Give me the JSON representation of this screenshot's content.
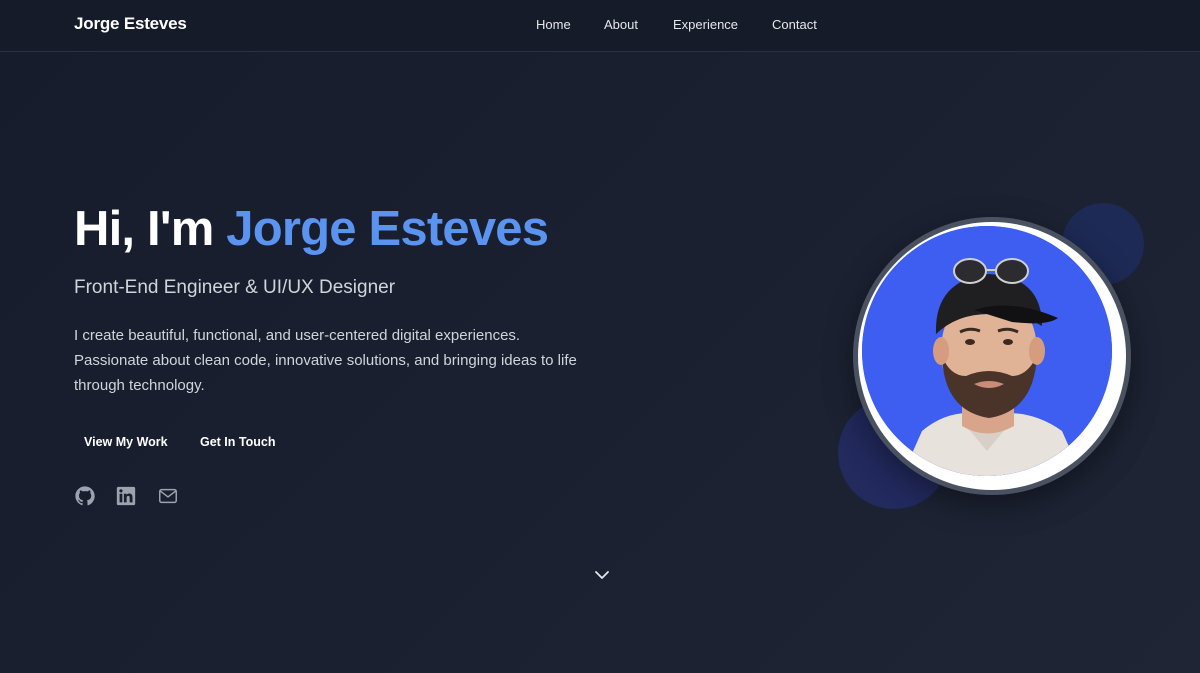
{
  "nav": {
    "brand": "Jorge Esteves",
    "links": [
      {
        "label": "Home"
      },
      {
        "label": "About"
      },
      {
        "label": "Experience"
      },
      {
        "label": "Contact"
      }
    ]
  },
  "hero": {
    "greeting": "Hi, I'm ",
    "name": "Jorge Esteves",
    "subtitle": "Front-End Engineer & UI/UX Designer",
    "description": "I create beautiful, functional, and user-centered digital experiences. Passionate about clean code, innovative solutions, and bringing ideas to life through technology.",
    "primary_button": "View My Work",
    "secondary_button": "Get In Touch"
  },
  "social": [
    {
      "icon": "github-icon"
    },
    {
      "icon": "linkedin-icon"
    },
    {
      "icon": "mail-icon"
    }
  ],
  "colors": {
    "accent": "#5b93f0",
    "background": "#1a2030",
    "avatar_bg": "#3d5ef0"
  }
}
